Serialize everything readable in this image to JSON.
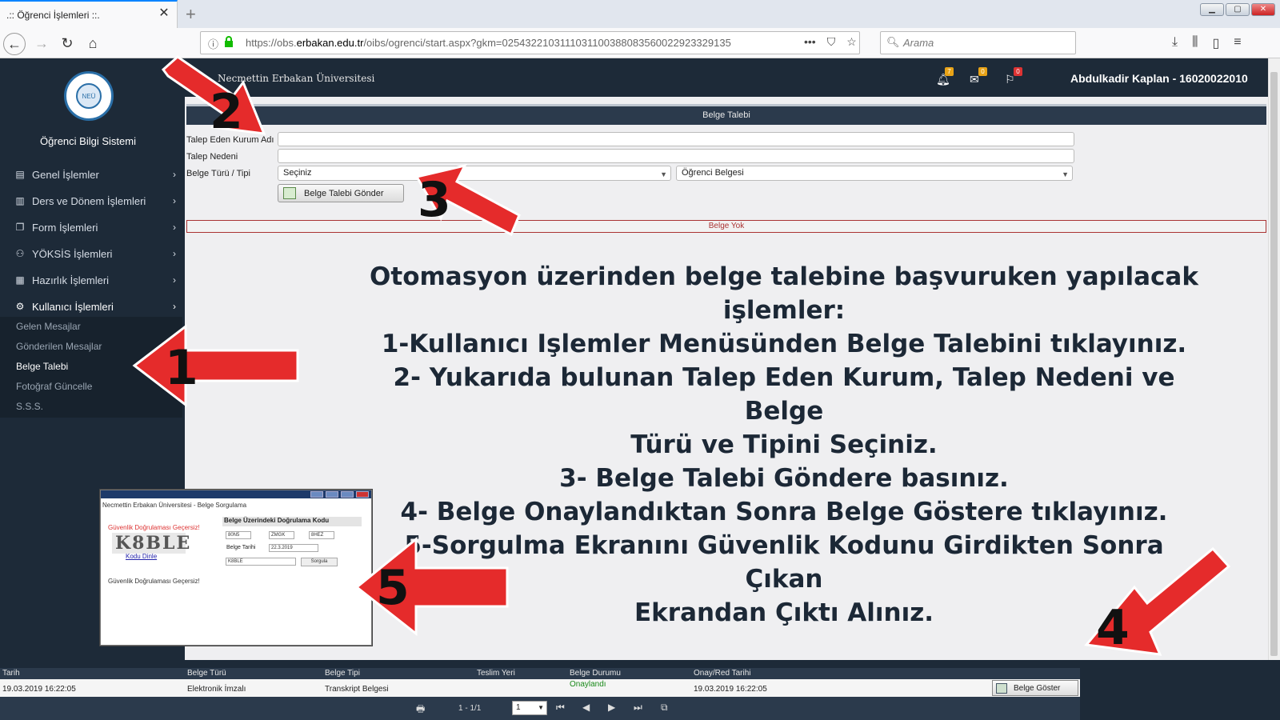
{
  "browser": {
    "tab_title": ".:: Öğrenci İşlemleri ::.",
    "url_prefix": "https://obs.",
    "url_domain": "erbakan.edu.tr",
    "url_rest": "/oibs/ogrenci/start.aspx?gkm=0254322103111031100388083560022923329135",
    "search_placeholder": "Arama"
  },
  "sidebar": {
    "system_title": "Öğrenci Bilgi Sistemi",
    "logo_text": "NEÜ",
    "items": [
      {
        "label": "Genel İşlemler",
        "icon": "id-card-icon"
      },
      {
        "label": "Ders ve Dönem İşlemleri",
        "icon": "map-icon"
      },
      {
        "label": "Form İşlemleri",
        "icon": "copy-icon"
      },
      {
        "label": "YÖKSİS İşlemleri",
        "icon": "users-icon"
      },
      {
        "label": "Hazırlık İşlemleri",
        "icon": "building-icon"
      },
      {
        "label": "Kullanıcı İşlemleri",
        "icon": "users-cog-icon"
      }
    ],
    "subitems": [
      "Gelen Mesajlar",
      "Gönderilen Mesajlar",
      "Belge Talebi",
      "Fotoğraf Güncelle",
      "S.S.S."
    ]
  },
  "header": {
    "university": "Necmettin Erbakan Üniversitesi",
    "notif_count": "7",
    "mail_count": "0",
    "flag_count": "0",
    "user": "Abdulkadir Kaplan - 16020022010"
  },
  "form": {
    "panel_title": "Belge Talebi",
    "label_institution": "Talep Eden Kurum Adı",
    "label_reason": "Talep Nedeni",
    "label_type": "Belge Türü / Tipi",
    "institution_value": "",
    "reason_value": "",
    "type_select": "Seçiniz",
    "subtype_select": "Öğrenci Belgesi",
    "send_button": "Belge Talebi Gönder",
    "no_document": "Belge Yok"
  },
  "instructions": [
    "Otomasyon üzerinden belge talebine başvuruken yapılacak",
    "işlemler:",
    "1-Kullanıcı Işlemler Menüsünden Belge Talebini tıklayınız.",
    "2- Yukarıda bulunan Talep Eden Kurum, Talep Nedeni ve Belge",
    "Türü ve Tipini Seçiniz.",
    "3- Belge Talebi Göndere basınız.",
    "4- Belge Onaylandıktan Sonra Belge Göstere tıklayınız.",
    "5-Sorgulma Ekranını Güvenlik Kodunu Girdikten Sonra Çıkan",
    "Ekrandan Çıktı Alınız."
  ],
  "arrow_numbers": [
    "1",
    "2",
    "3",
    "4",
    "5"
  ],
  "table": {
    "headers": [
      "Tarih",
      "Belge Türü",
      "Belge Tipi",
      "Teslim Yeri",
      "Belge Durumu",
      "Onay/Red Tarihi"
    ],
    "row": {
      "date": "19.03.2019 16:22:05",
      "type": "Elektronik İmzalı",
      "subtype": "Transkript Belgesi",
      "place": "",
      "status": "Onaylandı",
      "approval_date": "19.03.2019 16:22:05"
    },
    "show_button": "Belge Göster",
    "pager_text": "1 - 1/1",
    "page_value": "1"
  },
  "inset": {
    "title": "Necmettin Erbakan Üniversitesi - Belge Sorgulama",
    "captcha_error": "Güvenlik Doğrulaması Geçersiz!",
    "captcha_text": "K8BLE",
    "listen_link": "Kodu Dinle",
    "code_heading": "Belge Üzerindeki Doğrulama Kodu",
    "code1": "80N5",
    "code2": "ZMGK",
    "code3": "8HEZ",
    "date_label": "Belge Tarihi",
    "date_value": "22.3.2019",
    "input_value": "K8BLE",
    "query_button": "Sorgula",
    "bottom_error": "Güvenlik Doğrulaması Geçersiz!"
  },
  "colors": {
    "sidebar_bg": "#1d2a38",
    "arrow_red": "#e52b2b",
    "status_green": "#1a8a1a",
    "alert_red": "#aa3333"
  }
}
